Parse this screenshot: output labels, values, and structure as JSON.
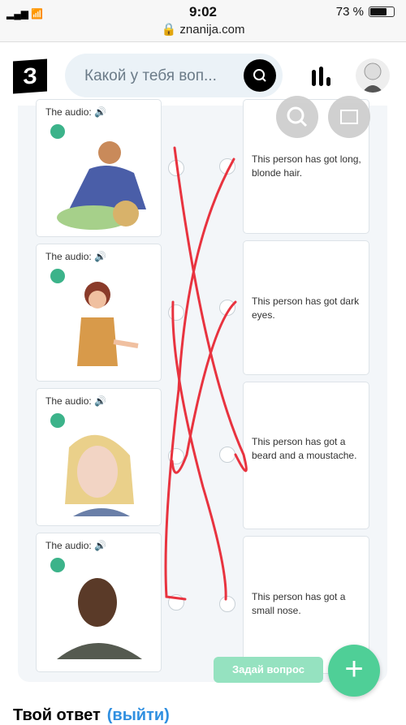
{
  "status_bar": {
    "time": "9:02",
    "url": "znanija.com",
    "battery": "73 %",
    "battery_level": 0.73
  },
  "header": {
    "logo": "З",
    "search_placeholder": "Какой у тебя воп...",
    "icons": [
      "search-icon",
      "stats-icon",
      "avatar"
    ]
  },
  "exercise": {
    "audio_label": "The audio:",
    "statements": [
      "This person has got long, blonde hair.",
      "This person has got dark eyes.",
      "This person has got a beard and a moustache.",
      "This person has got a small nose."
    ]
  },
  "actions": {
    "ask_button": "Задай вопрос",
    "plus": "+"
  },
  "answer": {
    "title": "Твой ответ",
    "exit": "(выйти)"
  },
  "colors": {
    "accent": "#4fcf97",
    "scribble": "#e8333f",
    "link": "#2f8fe0"
  }
}
